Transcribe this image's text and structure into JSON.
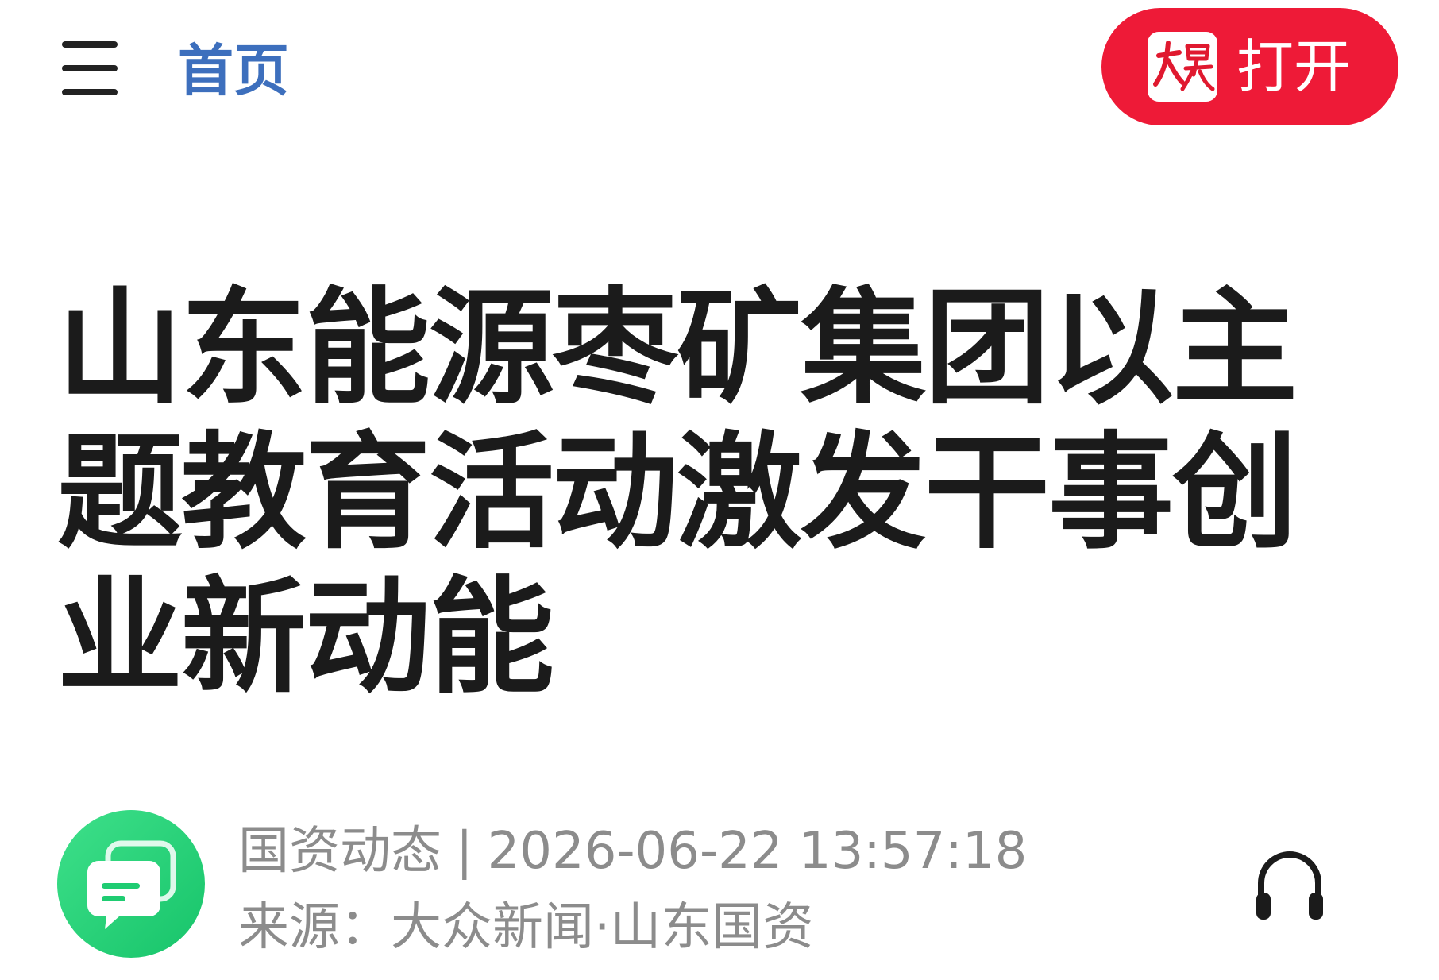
{
  "header": {
    "menu_icon": "hamburger-menu-icon",
    "home_label": "首页",
    "open_button": {
      "label": "打开",
      "logo_text": "大众",
      "color": "#ee1a37"
    }
  },
  "article": {
    "title": "山东能源枣矿集团以主题教育活动激发干事创业新动能",
    "channel": "国资动态",
    "separator": "|",
    "datetime": "2026-06-22 13:57:18",
    "source": "来源：大众新闻·山东国资",
    "avatar_icon": "chat-bubble-icon",
    "audio_icon": "headphone-icon"
  },
  "colors": {
    "accent_blue": "#3d6fbd",
    "brand_red": "#ee1a37",
    "avatar_green": "#1fcc72",
    "meta_gray": "#8c8c8c"
  }
}
